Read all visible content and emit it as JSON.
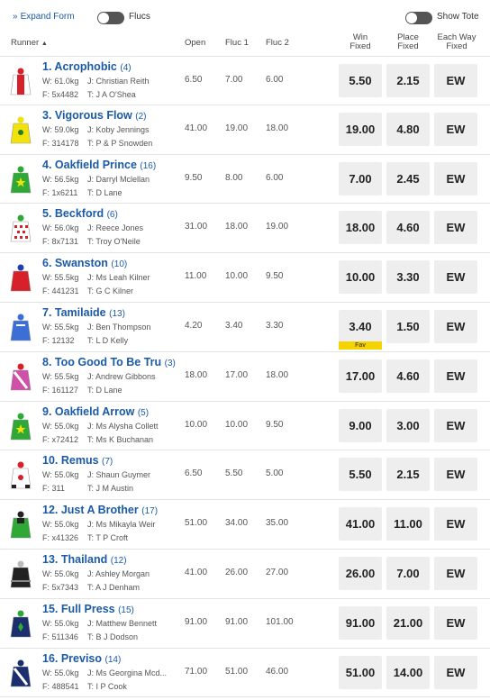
{
  "topbar": {
    "expand_label": "Expand Form",
    "flucs_label": "Flucs",
    "show_tote_label": "Show Tote"
  },
  "header": {
    "runner": "Runner",
    "open": "Open",
    "fluc1": "Fluc 1",
    "fluc2": "Fluc 2",
    "win": [
      "Win",
      "Fixed"
    ],
    "place": [
      "Place",
      "Fixed"
    ],
    "each_way": [
      "Each Way",
      "Fixed"
    ]
  },
  "runners": [
    {
      "number_name": "1. Acrophobic",
      "barrier": "(4)",
      "weight": "W: 61.0kg",
      "jockey": "J: Christian Reith",
      "form": "F: 5x4482",
      "trainer": "T: J A O'Shea",
      "open": "6.50",
      "fluc1": "7.00",
      "fluc2": "6.00",
      "win": "5.50",
      "place": "2.15",
      "ew": "EW",
      "silk": "red-white"
    },
    {
      "number_name": "3. Vigorous Flow",
      "barrier": "(2)",
      "weight": "W: 59.0kg",
      "jockey": "J: Koby Jennings",
      "form": "F: 314178",
      "trainer": "T: P & P Snowden",
      "open": "41.00",
      "fluc1": "19.00",
      "fluc2": "18.00",
      "win": "19.00",
      "place": "4.80",
      "ew": "EW",
      "silk": "yellow"
    },
    {
      "number_name": "4. Oakfield Prince",
      "barrier": "(16)",
      "weight": "W: 56.5kg",
      "jockey": "J: Darryl Mclellan",
      "form": "F: 1x6211",
      "trainer": "T: D Lane",
      "open": "9.50",
      "fluc1": "8.00",
      "fluc2": "6.00",
      "win": "7.00",
      "place": "2.45",
      "ew": "EW",
      "silk": "green-star"
    },
    {
      "number_name": "5. Beckford",
      "barrier": "(6)",
      "weight": "W: 56.0kg",
      "jockey": "J: Reece Jones",
      "form": "F: 8x7131",
      "trainer": "T: Troy O'Neile",
      "open": "31.00",
      "fluc1": "18.00",
      "fluc2": "19.00",
      "win": "18.00",
      "place": "4.60",
      "ew": "EW",
      "silk": "red-diamonds"
    },
    {
      "number_name": "6. Swanston",
      "barrier": "(10)",
      "weight": "W: 55.5kg",
      "jockey": "J: Ms Leah Kilner",
      "form": "F: 441231",
      "trainer": "T: G C Kilner",
      "open": "11.00",
      "fluc1": "10.00",
      "fluc2": "9.50",
      "win": "10.00",
      "place": "3.30",
      "ew": "EW",
      "silk": "red-blue-cap"
    },
    {
      "number_name": "7. Tamilaide",
      "barrier": "(13)",
      "weight": "W: 55.5kg",
      "jockey": "J: Ben Thompson",
      "form": "F: 12132",
      "trainer": "T: L D Kelly",
      "open": "4.20",
      "fluc1": "3.40",
      "fluc2": "3.30",
      "win": "3.40",
      "place": "1.50",
      "ew": "EW",
      "silk": "blue",
      "fav": "Fav"
    },
    {
      "number_name": "8. Too Good To Be Tru",
      "barrier": "(3)",
      "weight": "W: 55.5kg",
      "jockey": "J: Andrew Gibbons",
      "form": "F: 161127",
      "trainer": "T: D Lane",
      "open": "18.00",
      "fluc1": "17.00",
      "fluc2": "18.00",
      "win": "17.00",
      "place": "4.60",
      "ew": "EW",
      "silk": "pink-sash"
    },
    {
      "number_name": "9. Oakfield Arrow",
      "barrier": "(5)",
      "weight": "W: 55.0kg",
      "jockey": "J: Ms Alysha Collett",
      "form": "F: x72412",
      "trainer": "T: Ms K Buchanan",
      "open": "10.00",
      "fluc1": "10.00",
      "fluc2": "9.50",
      "win": "9.00",
      "place": "3.00",
      "ew": "EW",
      "silk": "green-star"
    },
    {
      "number_name": "10. Remus",
      "barrier": "(7)",
      "weight": "W: 55.0kg",
      "jockey": "J: Shaun Guymer",
      "form": "F: 311",
      "trainer": "T: J M Austin",
      "open": "6.50",
      "fluc1": "5.50",
      "fluc2": "5.00",
      "win": "5.50",
      "place": "2.15",
      "ew": "EW",
      "silk": "white-red"
    },
    {
      "number_name": "12. Just A Brother",
      "barrier": "(17)",
      "weight": "W: 55.0kg",
      "jockey": "J: Ms Mikayla Weir",
      "form": "F: x41326",
      "trainer": "T: T P Croft",
      "open": "51.00",
      "fluc1": "34.00",
      "fluc2": "35.00",
      "win": "41.00",
      "place": "11.00",
      "ew": "EW",
      "silk": "green-black"
    },
    {
      "number_name": "13. Thailand",
      "barrier": "(12)",
      "weight": "W: 55.0kg",
      "jockey": "J: Ashley Morgan",
      "form": "F: 5x7343",
      "trainer": "T: A J Denham",
      "open": "41.00",
      "fluc1": "26.00",
      "fluc2": "27.00",
      "win": "26.00",
      "place": "7.00",
      "ew": "EW",
      "silk": "black"
    },
    {
      "number_name": "15. Full Press",
      "barrier": "(15)",
      "weight": "W: 55.0kg",
      "jockey": "J: Matthew Bennett",
      "form": "F: 511346",
      "trainer": "T: B J Dodson",
      "open": "91.00",
      "fluc1": "91.00",
      "fluc2": "101.00",
      "win": "91.00",
      "place": "21.00",
      "ew": "EW",
      "silk": "navy-green"
    },
    {
      "number_name": "16. Previso",
      "barrier": "(14)",
      "weight": "W: 55.0kg",
      "jockey": "J: Ms Georgina Mcd...",
      "form": "F: 488541",
      "trainer": "T: I P Cook",
      "open": "71.00",
      "fluc1": "51.00",
      "fluc2": "46.00",
      "win": "51.00",
      "place": "14.00",
      "ew": "EW",
      "silk": "navy-white-sash"
    }
  ],
  "colors": {
    "link": "#1b5aa6",
    "button_bg": "#eeeeee",
    "fav_badge": "#f5d300"
  }
}
